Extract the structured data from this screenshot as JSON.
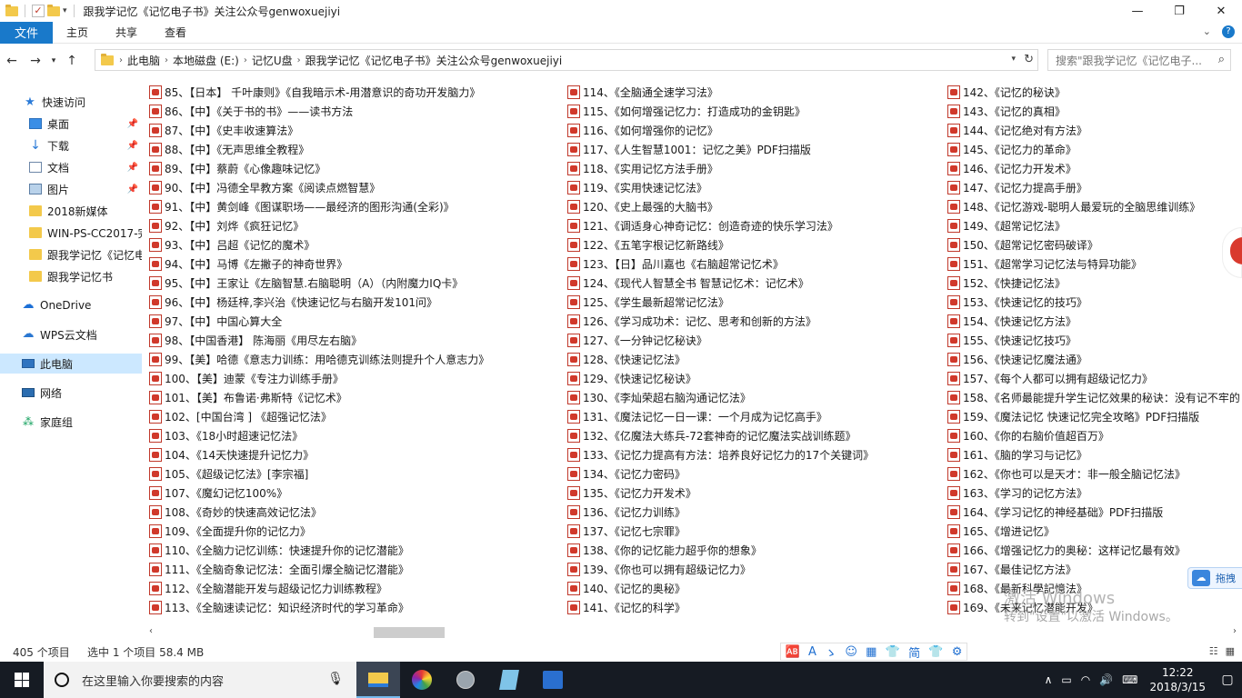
{
  "window": {
    "title": "跟我学记忆《记忆电子书》关注公众号genwoxuejiyi",
    "min": "—",
    "max": "❐",
    "close": "✕"
  },
  "ribbon": {
    "file": "文件",
    "tabs": [
      "主页",
      "共享",
      "查看"
    ],
    "expand": "⌄",
    "help": "?"
  },
  "address": {
    "crumbs": [
      "此电脑",
      "本地磁盘 (E:)",
      "记忆U盘",
      "跟我学记忆《记忆电子书》关注公众号genwoxuejiyi"
    ],
    "search_placeholder": "搜索\"跟我学记忆《记忆电子..."
  },
  "sidebar": {
    "items": [
      {
        "label": "快速访问"
      },
      {
        "label": "桌面",
        "pinned": true
      },
      {
        "label": "下载",
        "pinned": true
      },
      {
        "label": "文档",
        "pinned": true
      },
      {
        "label": "图片",
        "pinned": true
      },
      {
        "label": "2018新媒体"
      },
      {
        "label": "WIN-PS-CC2017-完"
      },
      {
        "label": "跟我学记忆《记忆电"
      },
      {
        "label": "跟我学记忆书"
      },
      {
        "label": "OneDrive"
      },
      {
        "label": "WPS云文档"
      },
      {
        "label": "此电脑",
        "selected": true
      },
      {
        "label": "网络"
      },
      {
        "label": "家庭组"
      }
    ]
  },
  "files": {
    "col1": [
      "85、【日本】 千叶康则》《自我暗示术-用潜意识的奇功开发脑力》",
      "86、【中】《关于书的书》——读书方法",
      "87、【中】《史丰收速算法》",
      "88、【中】《无声思维全教程》",
      "89、【中】蔡蔚《心像趣味记忆》",
      "90、【中】冯德全早教方案《阅读点燃智慧》",
      "91、【中】黄剑峰《图谋职场——最经济的图形沟通(全彩)》",
      "92、【中】刘烨《疯狂记忆》",
      "93、【中】吕超《记忆的魔术》",
      "94、【中】马博《左撇子的神奇世界》",
      "95、【中】王家让《左脑智慧.右脑聪明（A）（内附魔力IQ卡》",
      "96、【中】杨廷梓,李兴治《快速记忆与右脑开发101问》",
      "97、【中】中国心算大全",
      "98、【中国香港】 陈海丽《用尽左右脑》",
      "99、【美】哈德《意志力训练：用哈德克训练法则提升个人意志力》",
      "100、【美】迪蒙《专注力训练手册》",
      "101、【美】布鲁诺·弗斯特《记忆术》",
      "102、[中国台湾 ] 《超强记忆法》",
      "103、《18小时超速记忆法》",
      "104、《14天快速提升记忆力》",
      "105、《超级记忆法》[李宗福]",
      "107、《魔幻记忆100%》",
      "108、《奇妙的快速高效记忆法》",
      "109、《全面提升你的记忆力》",
      "110、《全脑力记忆训练：快速提升你的记忆潜能》",
      "111、《全脑奇象记忆法：全面引爆全脑记忆潜能》",
      "112、《全脑潜能开发与超级记忆力训练教程》",
      "113、《全脑速读记忆：知识经济时代的学习革命》"
    ],
    "col2": [
      "114、《全脑通全速学习法》",
      "115、《如何增强记忆力：打造成功的金钥匙》",
      "116、《如何增强你的记忆》",
      "117、《人生智慧1001：记忆之美》PDF扫描版",
      "118、《实用记忆方法手册》",
      "119、《实用快速记忆法》",
      "120、《史上最强的大脑书》",
      "121、《调适身心神奇记忆：创造奇迹的快乐学习法》",
      "122、《五笔字根记忆新路线》",
      "123、【日】品川嘉也《右脑超常记忆术》",
      "124、《现代人智慧全书  智慧记忆术：记忆术》",
      "125、《学生最新超常记忆法》",
      "126、《学习成功术：记忆、思考和创新的方法》",
      "127、《一分钟记忆秘诀》",
      "128、《快速记忆法》",
      "129、《快速记忆秘诀》",
      "130、《李灿荣超右脑沟通记忆法》",
      "131、《魔法记忆一日一课：一个月成为记忆高手》",
      "132、《亿魔法大练兵-72套神奇的记忆魔法实战训练题》",
      "133、《记忆力提高有方法：培养良好记忆力的17个关键词》",
      "134、《记忆力密码》",
      "135、《记忆力开发术》",
      "136、《记忆力训练》",
      "137、《记忆七宗罪》",
      "138、《你的记忆能力超乎你的想象》",
      "139、《你也可以拥有超级记忆力》",
      "140、《记忆的奥秘》",
      "141、《记忆的科学》"
    ],
    "col3": [
      "142、《记忆的秘诀》",
      "143、《记忆的真相》",
      "144、《记忆绝对有方法》",
      "145、《记忆力的革命》",
      "146、《记忆力开发术》",
      "147、《记忆力提高手册》",
      "148、《记忆游戏-聪明人最爱玩的全脑思维训练》",
      "149、《超常记忆法》",
      "150、《超常记忆密码破译》",
      "151、《超常学习记忆法与特异功能》",
      "152、《快捷记忆法》",
      "153、《快速记忆的技巧》",
      "154、《快速记忆方法》",
      "155、《快速记忆技巧》",
      "156、《快速记忆魔法通》",
      "157、《每个人都可以拥有超级记忆力》",
      "158、《名师最能提升学生记忆效果的秘诀：没有记不牢的",
      "159、《魔法记忆  快速记忆完全攻略》PDF扫描版",
      "160、《你的右脑价值超百万》",
      "161、《脑的学习与记忆》",
      "162、《你也可以是天才：非一般全脑记忆法》",
      "163、《学习的记忆方法》",
      "164、《学习记忆的神经基础》PDF扫描版",
      "165、《增进记忆》",
      "166、《增强记忆力的奥秘：这样记忆最有效》",
      "167、《最佳记忆方法》",
      "168、《最新科學記憶法》",
      "169、《未来记忆潜能开发》"
    ]
  },
  "status": {
    "count": "405 个项目",
    "selection": "选中 1 个项目  58.4 MB"
  },
  "ime": {
    "items": [
      "🆎",
      "A",
      "ゝ",
      "☺",
      "▦",
      "👕",
      "简",
      "👕",
      "⚙"
    ]
  },
  "drag_widget": {
    "label": "拖拽"
  },
  "watermark": {
    "line1": "激活 Windows",
    "line2": "转到\"设置\"以激活 Windows。"
  },
  "taskbar": {
    "search_placeholder": "在这里输入你要搜索的内容",
    "tray": [
      "∧",
      "▭",
      "◠",
      "🔊",
      "⌨"
    ],
    "time": "12:22",
    "date": "2018/3/15",
    "notification": "▢"
  }
}
